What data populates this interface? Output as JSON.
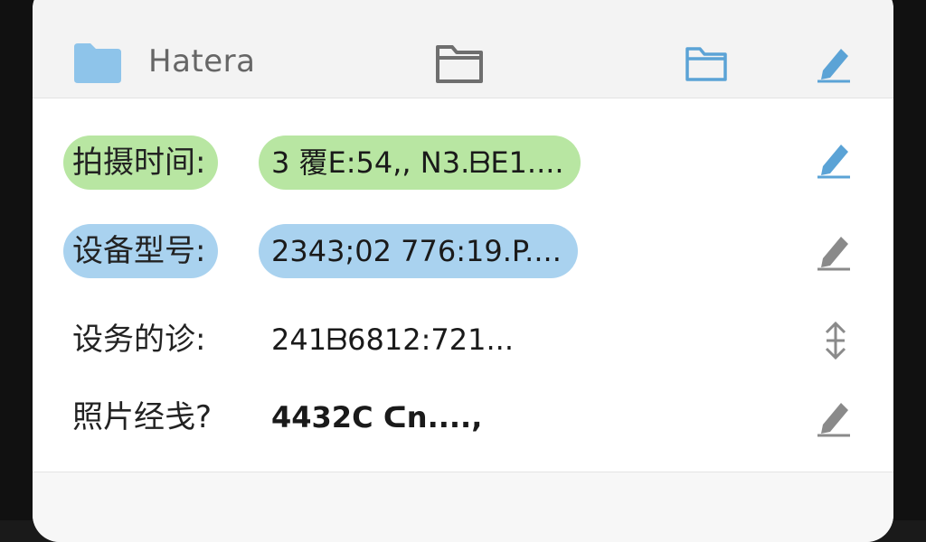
{
  "header": {
    "title": "Hatera",
    "icons": [
      "folder-blue-filled-icon",
      "folder-outline-icon",
      "folder-blue-outline-icon",
      "edit-icon"
    ]
  },
  "rows": [
    {
      "label": "拍摄时间:",
      "value": "3 覆E:54,, N3.ᗷE1....",
      "highlight": "#b8e6a2",
      "icon": "edit-icon"
    },
    {
      "label": "设备型号:",
      "value": "2343;02 776:19.P....",
      "highlight": "#a9d2ef",
      "icon": "edit-icon"
    },
    {
      "label": "设务的诊:",
      "value": "241ᗷ6812:721...",
      "highlight": "",
      "icon": "resize-vertical-icon"
    },
    {
      "label": "照片经戋?",
      "value": "4432C ᑕn....,",
      "highlight": "",
      "icon": "edit-icon"
    }
  ],
  "colors": {
    "accent_blue": "#5ba3d6",
    "green_highlight": "#b8e6a2",
    "blue_highlight": "#a9d2ef"
  }
}
